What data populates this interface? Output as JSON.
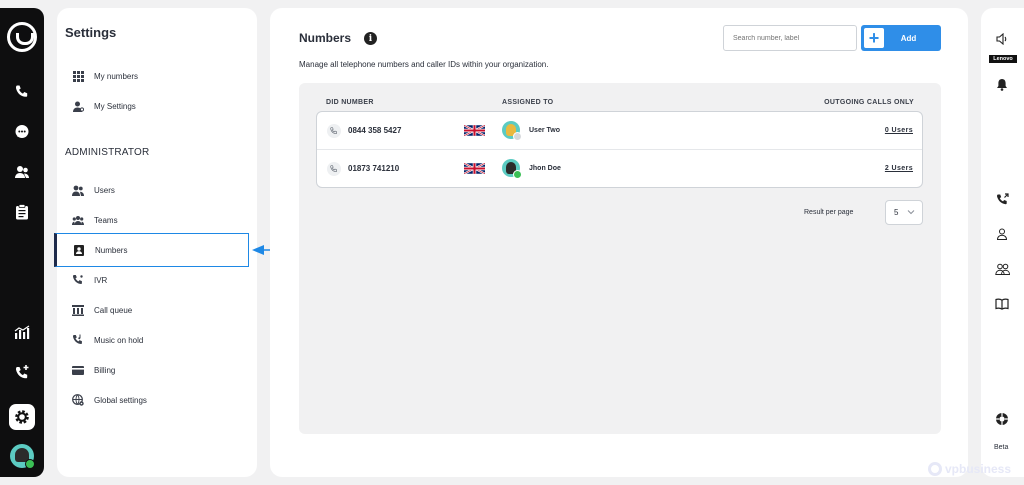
{
  "settings": {
    "title": "Settings",
    "items_top": [
      {
        "label": "My numbers",
        "icon": "grid-icon"
      },
      {
        "label": "My Settings",
        "icon": "user-gear-icon"
      }
    ],
    "section": "ADMINISTRATOR",
    "admin_items": [
      {
        "label": "Users",
        "icon": "users-icon"
      },
      {
        "label": "Teams",
        "icon": "team-icon"
      },
      {
        "label": "Numbers",
        "icon": "contact-card-icon",
        "active": true
      },
      {
        "label": "IVR",
        "icon": "ivr-icon"
      },
      {
        "label": "Call queue",
        "icon": "queue-icon"
      },
      {
        "label": "Music on hold",
        "icon": "music-phone-icon"
      },
      {
        "label": "Billing",
        "icon": "card-icon"
      },
      {
        "label": "Global settings",
        "icon": "globe-gear-icon"
      }
    ]
  },
  "main": {
    "title": "Numbers",
    "subtitle": "Manage all telephone numbers and caller IDs within your organization.",
    "search_placeholder": "Search number, label",
    "add_label": "Add",
    "columns": {
      "did": "DID NUMBER",
      "assigned": "ASSIGNED TO",
      "outgoing": "OUTGOING CALLS ONLY"
    },
    "rows": [
      {
        "number": "0844 358 5427",
        "user": "User Two",
        "outgoing": "0 Users",
        "status": "offline"
      },
      {
        "number": "01873 741210",
        "user": "Jhon Doe",
        "outgoing": "2 Users",
        "status": "online"
      }
    ],
    "result_per_page_label": "Result per page",
    "result_per_page_value": "5"
  },
  "right_rail": {
    "brand_badge": "Lenovo",
    "beta": "Beta"
  },
  "watermark": "vpbusiness",
  "colors": {
    "accent": "#2f8ee8",
    "rail": "#0e0e0f",
    "online": "#3bbf55"
  }
}
